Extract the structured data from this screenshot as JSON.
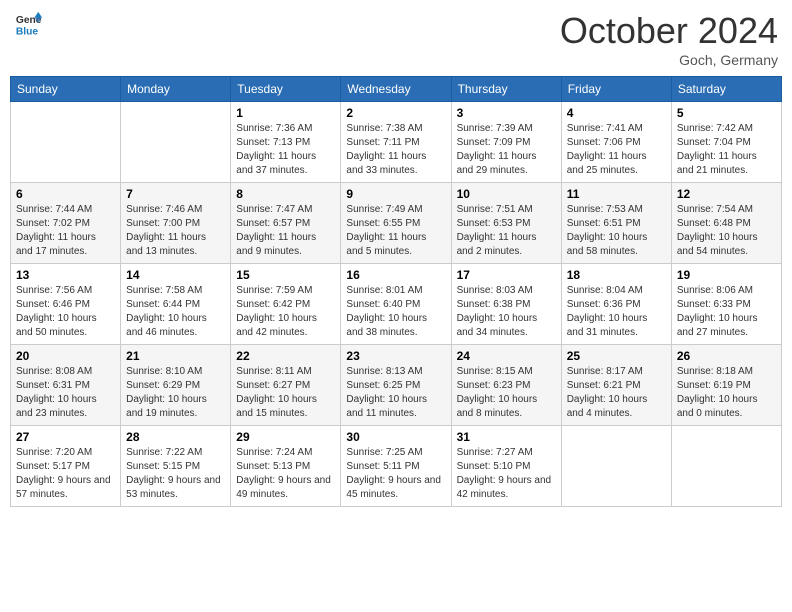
{
  "header": {
    "logo_line1": "General",
    "logo_line2": "Blue",
    "month_title": "October 2024",
    "location": "Goch, Germany"
  },
  "days_of_week": [
    "Sunday",
    "Monday",
    "Tuesday",
    "Wednesday",
    "Thursday",
    "Friday",
    "Saturday"
  ],
  "weeks": [
    [
      {
        "day": "",
        "info": ""
      },
      {
        "day": "",
        "info": ""
      },
      {
        "day": "1",
        "info": "Sunrise: 7:36 AM\nSunset: 7:13 PM\nDaylight: 11 hours and 37 minutes."
      },
      {
        "day": "2",
        "info": "Sunrise: 7:38 AM\nSunset: 7:11 PM\nDaylight: 11 hours and 33 minutes."
      },
      {
        "day": "3",
        "info": "Sunrise: 7:39 AM\nSunset: 7:09 PM\nDaylight: 11 hours and 29 minutes."
      },
      {
        "day": "4",
        "info": "Sunrise: 7:41 AM\nSunset: 7:06 PM\nDaylight: 11 hours and 25 minutes."
      },
      {
        "day": "5",
        "info": "Sunrise: 7:42 AM\nSunset: 7:04 PM\nDaylight: 11 hours and 21 minutes."
      }
    ],
    [
      {
        "day": "6",
        "info": "Sunrise: 7:44 AM\nSunset: 7:02 PM\nDaylight: 11 hours and 17 minutes."
      },
      {
        "day": "7",
        "info": "Sunrise: 7:46 AM\nSunset: 7:00 PM\nDaylight: 11 hours and 13 minutes."
      },
      {
        "day": "8",
        "info": "Sunrise: 7:47 AM\nSunset: 6:57 PM\nDaylight: 11 hours and 9 minutes."
      },
      {
        "day": "9",
        "info": "Sunrise: 7:49 AM\nSunset: 6:55 PM\nDaylight: 11 hours and 5 minutes."
      },
      {
        "day": "10",
        "info": "Sunrise: 7:51 AM\nSunset: 6:53 PM\nDaylight: 11 hours and 2 minutes."
      },
      {
        "day": "11",
        "info": "Sunrise: 7:53 AM\nSunset: 6:51 PM\nDaylight: 10 hours and 58 minutes."
      },
      {
        "day": "12",
        "info": "Sunrise: 7:54 AM\nSunset: 6:48 PM\nDaylight: 10 hours and 54 minutes."
      }
    ],
    [
      {
        "day": "13",
        "info": "Sunrise: 7:56 AM\nSunset: 6:46 PM\nDaylight: 10 hours and 50 minutes."
      },
      {
        "day": "14",
        "info": "Sunrise: 7:58 AM\nSunset: 6:44 PM\nDaylight: 10 hours and 46 minutes."
      },
      {
        "day": "15",
        "info": "Sunrise: 7:59 AM\nSunset: 6:42 PM\nDaylight: 10 hours and 42 minutes."
      },
      {
        "day": "16",
        "info": "Sunrise: 8:01 AM\nSunset: 6:40 PM\nDaylight: 10 hours and 38 minutes."
      },
      {
        "day": "17",
        "info": "Sunrise: 8:03 AM\nSunset: 6:38 PM\nDaylight: 10 hours and 34 minutes."
      },
      {
        "day": "18",
        "info": "Sunrise: 8:04 AM\nSunset: 6:36 PM\nDaylight: 10 hours and 31 minutes."
      },
      {
        "day": "19",
        "info": "Sunrise: 8:06 AM\nSunset: 6:33 PM\nDaylight: 10 hours and 27 minutes."
      }
    ],
    [
      {
        "day": "20",
        "info": "Sunrise: 8:08 AM\nSunset: 6:31 PM\nDaylight: 10 hours and 23 minutes."
      },
      {
        "day": "21",
        "info": "Sunrise: 8:10 AM\nSunset: 6:29 PM\nDaylight: 10 hours and 19 minutes."
      },
      {
        "day": "22",
        "info": "Sunrise: 8:11 AM\nSunset: 6:27 PM\nDaylight: 10 hours and 15 minutes."
      },
      {
        "day": "23",
        "info": "Sunrise: 8:13 AM\nSunset: 6:25 PM\nDaylight: 10 hours and 11 minutes."
      },
      {
        "day": "24",
        "info": "Sunrise: 8:15 AM\nSunset: 6:23 PM\nDaylight: 10 hours and 8 minutes."
      },
      {
        "day": "25",
        "info": "Sunrise: 8:17 AM\nSunset: 6:21 PM\nDaylight: 10 hours and 4 minutes."
      },
      {
        "day": "26",
        "info": "Sunrise: 8:18 AM\nSunset: 6:19 PM\nDaylight: 10 hours and 0 minutes."
      }
    ],
    [
      {
        "day": "27",
        "info": "Sunrise: 7:20 AM\nSunset: 5:17 PM\nDaylight: 9 hours and 57 minutes."
      },
      {
        "day": "28",
        "info": "Sunrise: 7:22 AM\nSunset: 5:15 PM\nDaylight: 9 hours and 53 minutes."
      },
      {
        "day": "29",
        "info": "Sunrise: 7:24 AM\nSunset: 5:13 PM\nDaylight: 9 hours and 49 minutes."
      },
      {
        "day": "30",
        "info": "Sunrise: 7:25 AM\nSunset: 5:11 PM\nDaylight: 9 hours and 45 minutes."
      },
      {
        "day": "31",
        "info": "Sunrise: 7:27 AM\nSunset: 5:10 PM\nDaylight: 9 hours and 42 minutes."
      },
      {
        "day": "",
        "info": ""
      },
      {
        "day": "",
        "info": ""
      }
    ]
  ]
}
